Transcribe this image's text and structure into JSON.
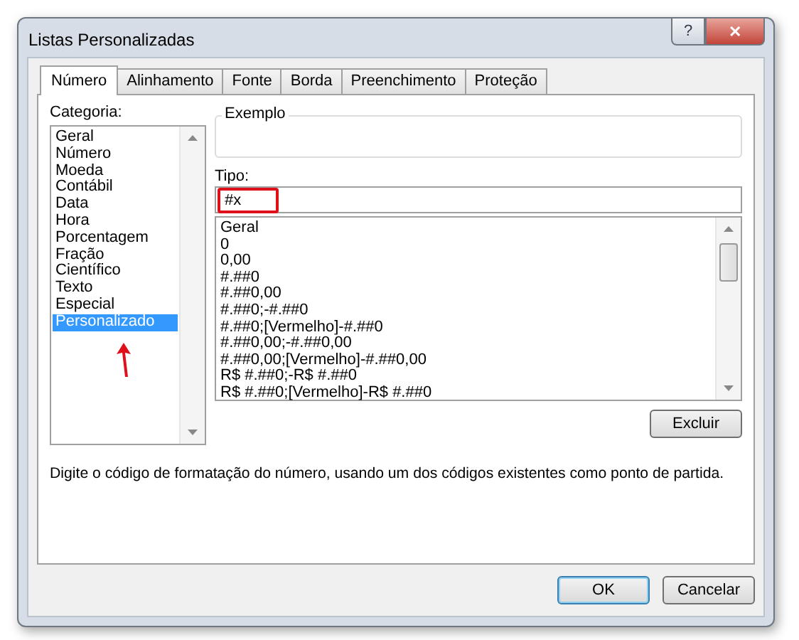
{
  "window": {
    "title": "Listas Personalizadas",
    "help_button": "?",
    "close_button": "✕"
  },
  "tabs": [
    {
      "label": "Número",
      "selected": true
    },
    {
      "label": "Alinhamento",
      "selected": false
    },
    {
      "label": "Fonte",
      "selected": false
    },
    {
      "label": "Borda",
      "selected": false
    },
    {
      "label": "Preenchimento",
      "selected": false
    },
    {
      "label": "Proteção",
      "selected": false
    }
  ],
  "category": {
    "label": "Categoria:",
    "items": [
      {
        "label": "Geral",
        "selected": false
      },
      {
        "label": "Número",
        "selected": false
      },
      {
        "label": "Moeda",
        "selected": false
      },
      {
        "label": "Contábil",
        "selected": false
      },
      {
        "label": "Data",
        "selected": false
      },
      {
        "label": "Hora",
        "selected": false
      },
      {
        "label": "Porcentagem",
        "selected": false
      },
      {
        "label": "Fração",
        "selected": false
      },
      {
        "label": "Científico",
        "selected": false
      },
      {
        "label": "Texto",
        "selected": false
      },
      {
        "label": "Especial",
        "selected": false
      },
      {
        "label": "Personalizado",
        "selected": true
      }
    ]
  },
  "sample": {
    "label": "Exemplo"
  },
  "type": {
    "label": "Tipo:",
    "value": "#x",
    "highlighted": true,
    "items": [
      "Geral",
      "0",
      "0,00",
      "#.##0",
      "#.##0,00",
      "#.##0;-#.##0",
      "#.##0;[Vermelho]-#.##0",
      "#.##0,00;-#.##0,00",
      "#.##0,00;[Vermelho]-#.##0,00",
      "R$ #.##0;-R$ #.##0",
      "R$ #.##0;[Vermelho]-R$ #.##0"
    ]
  },
  "arrow_to_selected": true,
  "delete_button": "Excluir",
  "description": "Digite o código de formatação do número, usando um dos códigos existentes como ponto de partida.",
  "buttons": [
    {
      "label": "OK",
      "default": true
    },
    {
      "label": "Cancelar",
      "default": false
    }
  ]
}
